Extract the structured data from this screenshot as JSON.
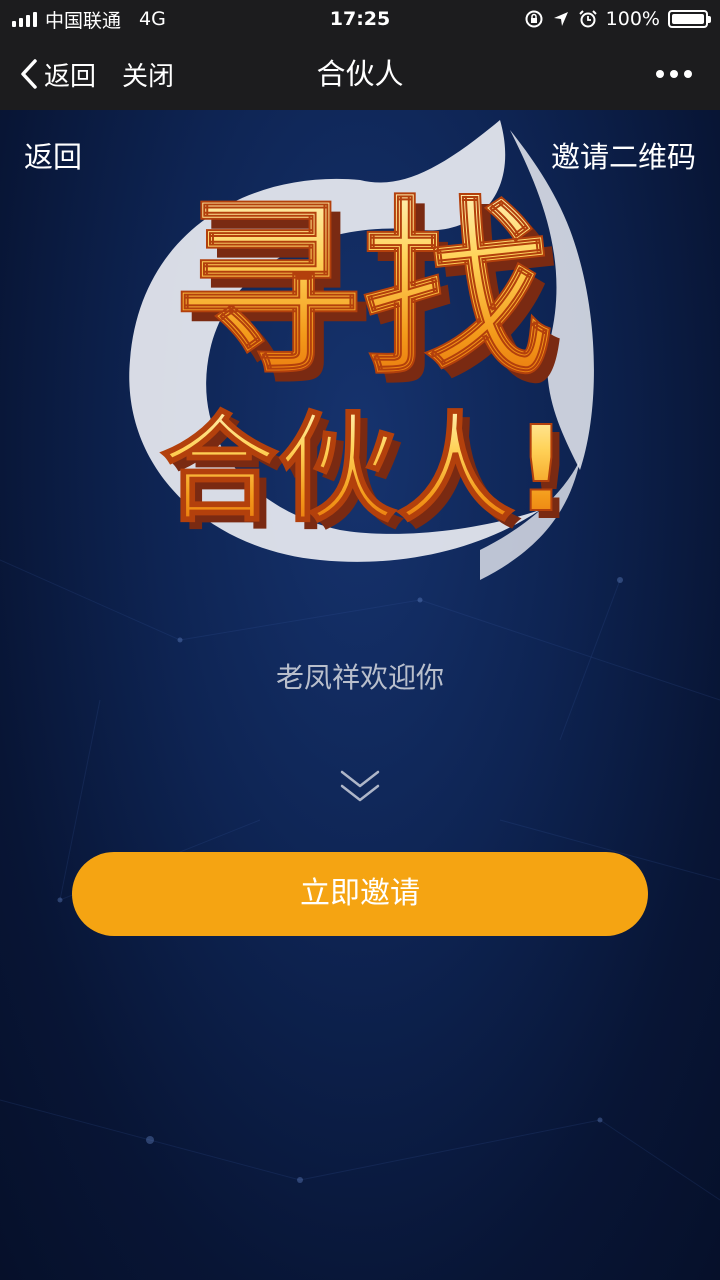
{
  "status_bar": {
    "carrier": "中国联通",
    "network": "4G",
    "time": "17:25",
    "battery": "100%"
  },
  "nav_bar": {
    "back_label": "返回",
    "close_label": "关闭",
    "title": "合伙人"
  },
  "page": {
    "back_link": "返回",
    "qr_link": "邀请二维码",
    "banner": {
      "line1": "寻找",
      "line2": "合伙人!"
    },
    "welcome_text": "老凤祥欢迎你",
    "invite_button": "立即邀请"
  },
  "colors": {
    "accent": "#f5a412",
    "background": "#0e2453",
    "navbar": "#1c1c1e"
  }
}
